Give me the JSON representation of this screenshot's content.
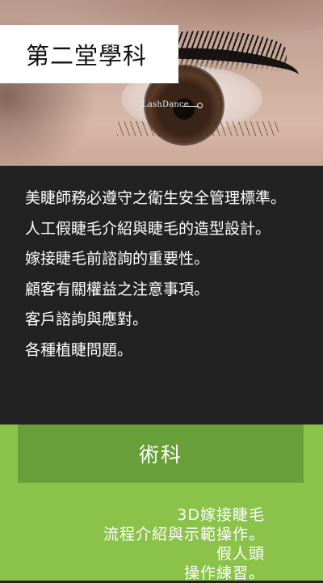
{
  "hero": {
    "title": "第二堂學科",
    "watermark": "LashDance"
  },
  "academic": {
    "items": [
      "美睫師務必遵守之衛生安全管理標準。",
      "人工假睫毛介紹與睫毛的造型設計。",
      "嫁接睫毛前諮詢的重要性。",
      "顧客有關權益之注意事項。",
      "客戶諮詢與應對。",
      "各種植睫問題。"
    ]
  },
  "practical": {
    "header": "術科",
    "lines": [
      "3D嫁接睫毛",
      "流程介紹與示範操作。",
      "假人頭",
      "操作練習。"
    ]
  },
  "colors": {
    "dark_bg": "#222222",
    "green_bg": "#8bc34a",
    "green_header": "#689f38",
    "text_light": "#ffffff"
  }
}
